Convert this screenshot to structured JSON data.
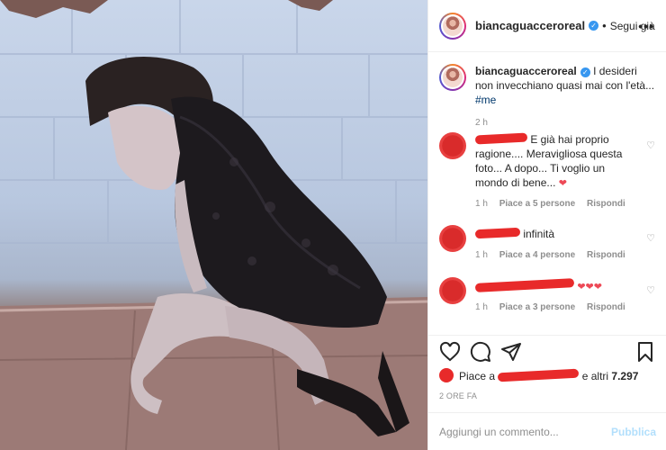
{
  "header": {
    "username": "biancaguacceroreal",
    "verified_mark": "✓",
    "separator": "•",
    "follow_label": "Segui già",
    "more_label": "•••"
  },
  "caption": {
    "username": "biancaguacceroreal",
    "text": " I desideri non invecchiano quasi mai con l'età... ",
    "hashtag": "#me",
    "time": "2 h"
  },
  "comments": [
    {
      "text": "E già hai proprio ragione.... Meravigliosa questa foto... A dopo... Ti voglio un mondo di bene...",
      "heart": "❤",
      "time": "1 h",
      "likes": "Piace a 5 persone",
      "reply": "Rispondi"
    },
    {
      "text": "infinità",
      "time": "1 h",
      "likes": "Piace a 4 persone",
      "reply": "Rispondi"
    },
    {
      "hearts": "❤❤❤",
      "time": "1 h",
      "likes": "Piace a 3 persone",
      "reply": "Rispondi"
    }
  ],
  "actions": {
    "likes_prefix": "Piace a",
    "likes_middle": "e altri",
    "likes_count": "7.297",
    "ago": "2 ORE FA"
  },
  "add_comment": {
    "placeholder": "Aggiungi un commento...",
    "publish": "Pubblica"
  },
  "icons": {
    "heart": "heart-icon",
    "comment": "comment-icon",
    "share": "share-icon",
    "bookmark": "bookmark-icon",
    "comment_like": "heart-outline-icon"
  },
  "colors": {
    "verified": "#3897f0",
    "link": "#00376b",
    "redaction": "#e82a2a",
    "publish_disabled": "#b2dffc"
  }
}
